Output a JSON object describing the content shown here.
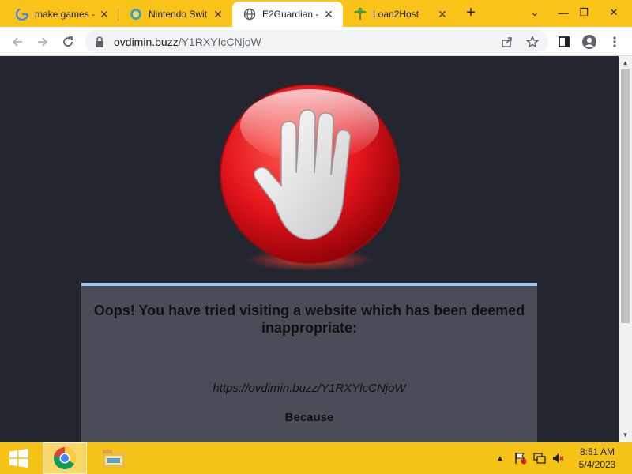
{
  "browser": {
    "tabs": [
      {
        "title": "make games -",
        "favicon": "google-g-icon",
        "active": false
      },
      {
        "title": "Nintendo Swit",
        "favicon": "nintendo-icon",
        "active": false
      },
      {
        "title": "E2Guardian -",
        "favicon": "globe-icon",
        "active": true
      },
      {
        "title": "Loan2Host",
        "favicon": "palm-tree-icon",
        "active": false
      }
    ],
    "new_tab": "+",
    "address": {
      "domain": "ovdimin.buzz",
      "path": "/Y1RXYIcCNjoW"
    }
  },
  "page": {
    "headline": "Oops! You have tried visiting a website which has been deemed inappropriate:",
    "blocked_url": "https://ovdimin.buzz/Y1RXYlcCNjoW",
    "because": "Because",
    "colors": {
      "background": "#24262f",
      "panel": "#4a4d57",
      "panel_border": "#9fc8f0",
      "stop_red": "#e3141c"
    }
  },
  "taskbar": {
    "clock_time": "8:51 AM",
    "clock_date": "5/4/2023",
    "apps": [
      "windows-start-icon",
      "chrome-icon",
      "file-explorer-icon"
    ]
  }
}
